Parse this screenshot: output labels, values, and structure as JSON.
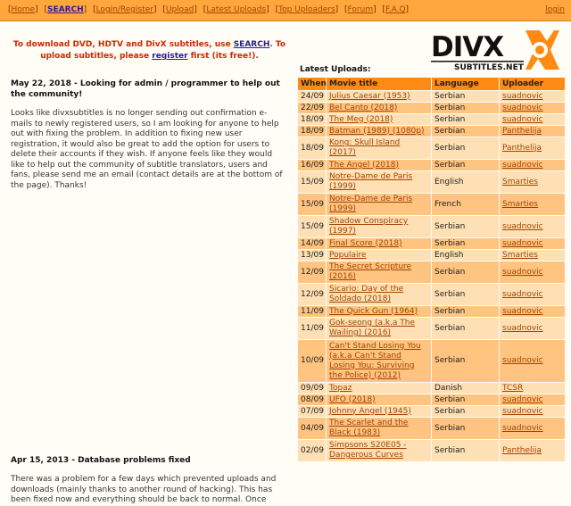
{
  "nav": {
    "items": [
      "Home",
      "SEARCH",
      "Login/Register",
      "Upload",
      "Latest Uploads",
      "Top Uploaders",
      "Forum",
      "F.A.Q"
    ],
    "login": "login"
  },
  "promo": {
    "t1": "To download DVD, HDTV and DivX subtitles, use ",
    "search": "SEARCH",
    "t2": ". To upload subtitles, please ",
    "register": "register",
    "t3": " first (its free!)."
  },
  "logo": {
    "main": "DIVX",
    "sub": "SUBTITLES.NET"
  },
  "news": [
    {
      "head": "May 22, 2018 - Looking for admin / programmer to help out the community!",
      "body": "Looks like divxsubtitles is no longer sending out confirmation e-mails to newly registered users, so I am looking for anyone to help out with fixing the problem. In addition to fixing new user registration, it would also be great to add the option for users to delete their accounts if they wish. If anyone feels like they would like to help out the community of subtitle translators, users and fans, please send me an email (contact details are at the bottom of the page). Thanks!"
    },
    {
      "head": "Apr 15, 2013 - Database problems fixed",
      "body": "There was a problem for a few days which prevented uploads and downloads (mainly thanks to another round of hacking). This has been fixed now and everything should be back to normal. Once"
    }
  ],
  "latest": {
    "title": "Latest Uploads:",
    "headers": [
      "When",
      "Movie title",
      "Language",
      "Uploader"
    ],
    "rows": [
      [
        "24/09",
        "Julius Caesar (1953)",
        "Serbian",
        "suadnovic"
      ],
      [
        "22/09",
        "Bel Canto (2018)",
        "Serbian",
        "suadnovic"
      ],
      [
        "18/09",
        "The Meg (2018)",
        "Serbian",
        "suadnovic"
      ],
      [
        "18/09",
        "Batman (1989) (1080p)",
        "Serbian",
        "Panthelija"
      ],
      [
        "18/09",
        "Kong: Skull Island (2017)",
        "Serbian",
        "Panthelija"
      ],
      [
        "16/09",
        "The Angel (2018)",
        "Serbian",
        "suadnovic"
      ],
      [
        "15/09",
        "Notre-Dame de Paris (1999)",
        "English",
        "Smarties"
      ],
      [
        "15/09",
        "Notre-Dame de Paris (1999)",
        "French",
        "Smarties"
      ],
      [
        "15/09",
        "Shadow Conspiracy (1997)",
        "Serbian",
        "suadnovic"
      ],
      [
        "14/09",
        "Final Score (2018)",
        "Serbian",
        "suadnovic"
      ],
      [
        "13/09",
        "Populaire",
        "English",
        "Smarties"
      ],
      [
        "12/09",
        "The Secret Scripture (2016)",
        "Serbian",
        "suadnovic"
      ],
      [
        "12/09",
        "Sicario: Day of the Soldado (2018)",
        "Serbian",
        "suadnovic"
      ],
      [
        "11/09",
        "The Quick Gun (1964)",
        "Serbian",
        "suadnovic"
      ],
      [
        "11/09",
        "Gok-seong (a.k.a The Wailing) (2016)",
        "Serbian",
        "suadnovic"
      ],
      [
        "10/09",
        "Can't Stand Losing You (a.k.a Can't Stand Losing You: Surviving the Police) (2012)",
        "Serbian",
        "suadnovic"
      ],
      [
        "09/09",
        "Topaz",
        "Danish",
        "TCSR"
      ],
      [
        "08/09",
        "UFO (2018)",
        "Serbian",
        "suadnovic"
      ],
      [
        "07/09",
        "Johnny Angel (1945)",
        "Serbian",
        "suadnovic"
      ],
      [
        "04/09",
        "The Scarlet and the Black (1983)",
        "Serbian",
        "suadnovic"
      ],
      [
        "02/09",
        "Simpsons S20E05 - Dangerous Curves",
        "Serbian",
        "Panthelija"
      ]
    ]
  }
}
